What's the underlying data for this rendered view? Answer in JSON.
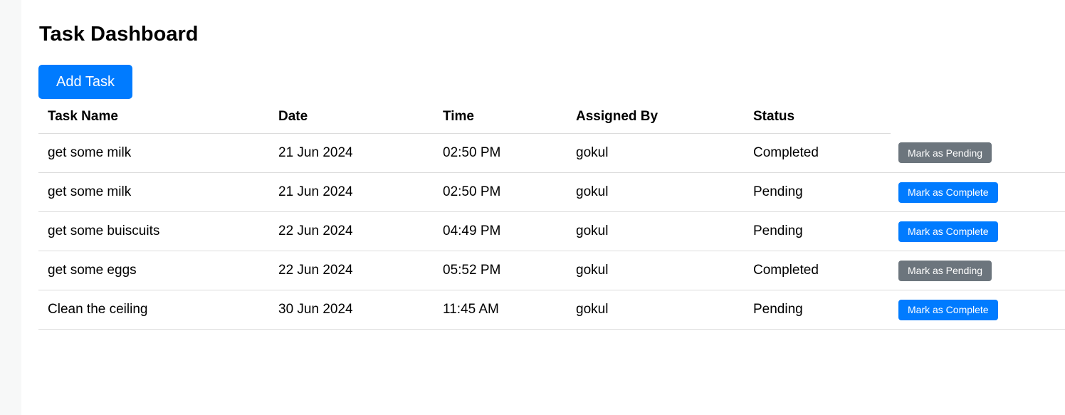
{
  "page": {
    "title": "Task Dashboard",
    "add_task_label": "Add Task"
  },
  "table": {
    "headers": [
      "Task Name",
      "Date",
      "Time",
      "Assigned By",
      "Status"
    ],
    "rows": [
      {
        "name": "get some milk",
        "date": "21 Jun 2024",
        "time": "02:50 PM",
        "assigned_by": "gokul",
        "status": "Completed",
        "action": "Mark as Pending"
      },
      {
        "name": "get some milk",
        "date": "21 Jun 2024",
        "time": "02:50 PM",
        "assigned_by": "gokul",
        "status": "Pending",
        "action": "Mark as Complete"
      },
      {
        "name": "get some buiscuits",
        "date": "22 Jun 2024",
        "time": "04:49 PM",
        "assigned_by": "gokul",
        "status": "Pending",
        "action": "Mark as Complete"
      },
      {
        "name": "get some eggs",
        "date": "22 Jun 2024",
        "time": "05:52 PM",
        "assigned_by": "gokul",
        "status": "Completed",
        "action": "Mark as Pending"
      },
      {
        "name": "Clean the ceiling",
        "date": "30 Jun 2024",
        "time": "11:45 AM",
        "assigned_by": "gokul",
        "status": "Pending",
        "action": "Mark as Complete"
      }
    ]
  },
  "colors": {
    "primary": "#007bff",
    "secondary": "#6c757d",
    "sidebar": "#f7f8f8",
    "row_border": "#dcdcdc"
  }
}
